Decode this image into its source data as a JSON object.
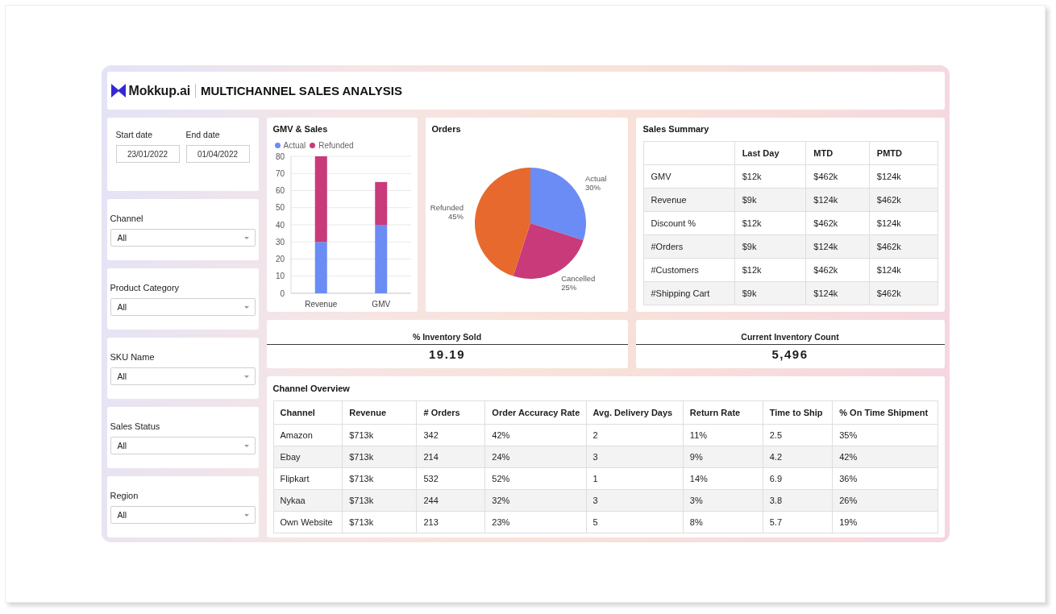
{
  "header": {
    "brand": "Mokkup.ai",
    "title": "MULTICHANNEL SALES ANALYSIS"
  },
  "date_fields": [
    {
      "label": "Start date",
      "value": "23/01/2022"
    },
    {
      "label": "End date",
      "value": "01/04/2022"
    }
  ],
  "filters": [
    {
      "label": "Channel",
      "value": "All"
    },
    {
      "label": "Product Category",
      "value": "All"
    },
    {
      "label": "SKU Name",
      "value": "All"
    },
    {
      "label": "Sales Status",
      "value": "All"
    },
    {
      "label": "Region",
      "value": "All"
    }
  ],
  "gmv_sales": {
    "title": "GMV & Sales",
    "chart_data": {
      "type": "bar",
      "categories": [
        "Revenue",
        "GMV"
      ],
      "series": [
        {
          "name": "Actual",
          "color": "#6b8cf4",
          "values": [
            30,
            40
          ]
        },
        {
          "name": "Refunded",
          "color": "#c83a7a",
          "values": [
            50,
            25
          ]
        }
      ],
      "ylim": [
        0,
        80
      ],
      "yticks": [
        0,
        10,
        20,
        30,
        40,
        50,
        60,
        70,
        80
      ],
      "stacked": true,
      "grid": true
    }
  },
  "orders": {
    "title": "Orders",
    "chart_data": {
      "type": "pie",
      "categories": [
        "Actual",
        "Cancelled",
        "Refunded"
      ],
      "values": [
        30,
        25,
        45
      ],
      "colors": [
        "#6b8cf4",
        "#c83a7a",
        "#e8692d"
      ],
      "value_labels": [
        "30%",
        "25%",
        "45%"
      ]
    }
  },
  "sales_summary": {
    "title": "Sales Summary",
    "columns": [
      "Last Day",
      "MTD",
      "PMTD"
    ],
    "rows": [
      {
        "label": "GMV",
        "values": [
          "$12k",
          "$462k",
          "$124k"
        ]
      },
      {
        "label": "Revenue",
        "values": [
          "$9k",
          "$124k",
          "$462k"
        ]
      },
      {
        "label": "Discount %",
        "values": [
          "$12k",
          "$462k",
          "$124k"
        ]
      },
      {
        "label": "#Orders",
        "values": [
          "$9k",
          "$124k",
          "$462k"
        ]
      },
      {
        "label": "#Customers",
        "values": [
          "$12k",
          "$462k",
          "$124k"
        ]
      },
      {
        "label": "#Shipping Cart",
        "values": [
          "$9k",
          "$124k",
          "$462k"
        ]
      }
    ]
  },
  "kpis": [
    {
      "label": "% Inventory Sold",
      "value": "19.19"
    },
    {
      "label": "Current Inventory Count",
      "value": "5,496"
    }
  ],
  "channel_overview": {
    "title": "Channel Overview",
    "columns": [
      "Channel",
      "Revenue",
      "# Orders",
      "Order Accuracy Rate",
      "Avg. Delivery Days",
      "Return Rate",
      "Time to Ship",
      "% On Time Shipment"
    ],
    "rows": [
      [
        "Amazon",
        "$713k",
        "342",
        "42%",
        "2",
        "11%",
        "2.5",
        "35%"
      ],
      [
        "Ebay",
        "$713k",
        "214",
        "24%",
        "3",
        "9%",
        "4.2",
        "42%"
      ],
      [
        "Flipkart",
        "$713k",
        "532",
        "52%",
        "1",
        "14%",
        "6.9",
        "36%"
      ],
      [
        "Nykaa",
        "$713k",
        "244",
        "32%",
        "3",
        "3%",
        "3.8",
        "26%"
      ],
      [
        "Own Website",
        "$713k",
        "213",
        "23%",
        "5",
        "8%",
        "5.7",
        "19%"
      ]
    ]
  }
}
